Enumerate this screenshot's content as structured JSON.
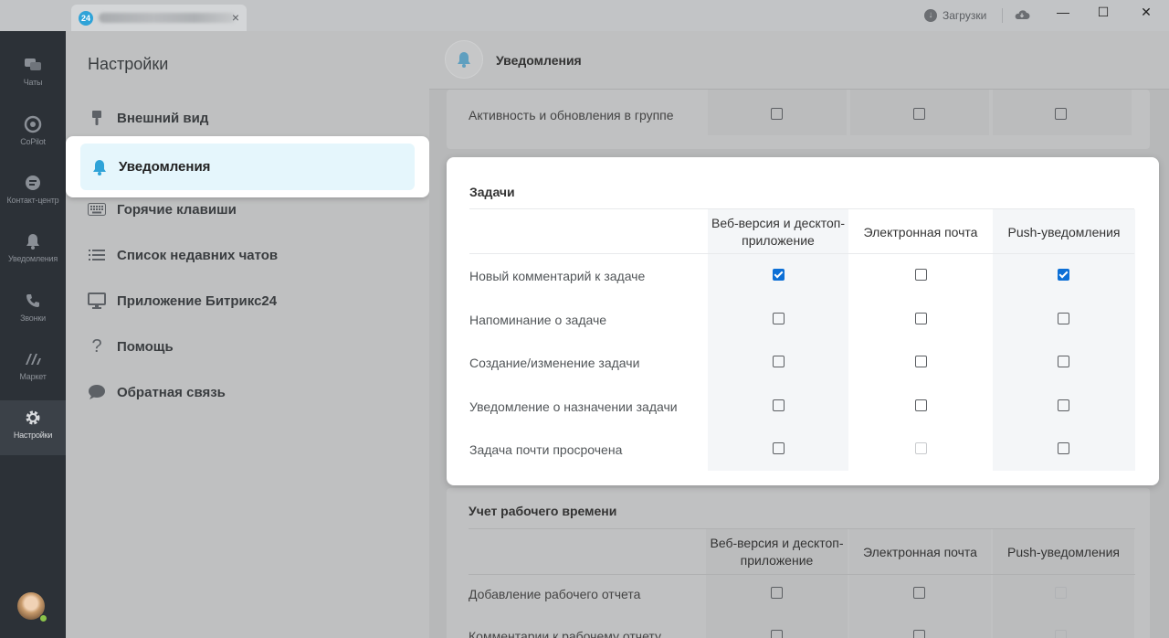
{
  "titlebar": {
    "tab_badge": "24",
    "tab_close": "×",
    "downloads_label": "Загрузки",
    "minimize": "—",
    "maximize": "☐",
    "close": "✕"
  },
  "sidebar": {
    "items": [
      {
        "label": "Чаты",
        "icon": "chat-icon"
      },
      {
        "label": "CoPilot",
        "icon": "copilot-icon"
      },
      {
        "label": "Контакт-центр",
        "icon": "contact-center-icon"
      },
      {
        "label": "Уведомления",
        "icon": "bell-icon"
      },
      {
        "label": "Звонки",
        "icon": "phone-icon"
      },
      {
        "label": "Маркет",
        "icon": "market-icon"
      },
      {
        "label": "Настройки",
        "icon": "gear-icon"
      }
    ]
  },
  "settings_nav": {
    "title": "Настройки",
    "items": [
      {
        "label": "Внешний вид",
        "icon": "brush-icon"
      },
      {
        "label": "Уведомления",
        "icon": "bell-icon"
      },
      {
        "label": "Горячие клавиши",
        "icon": "keyboard-icon"
      },
      {
        "label": "Список недавних чатов",
        "icon": "list-icon"
      },
      {
        "label": "Приложение Битрикс24",
        "icon": "monitor-icon"
      },
      {
        "label": "Помощь",
        "icon": "question-icon"
      },
      {
        "label": "Обратная связь",
        "icon": "speech-bubble-icon"
      }
    ]
  },
  "main": {
    "header_title": "Уведомления",
    "group_row": {
      "label": "Активность и обновления в группе",
      "values": [
        false,
        false,
        false
      ]
    },
    "columns": [
      "Веб-версия и десктоп-приложение",
      "Электронная почта",
      "Push-уведомления"
    ],
    "tasks": {
      "title": "Задачи",
      "rows": [
        {
          "label": "Новый комментарий к задаче",
          "values": [
            true,
            false,
            true
          ]
        },
        {
          "label": "Напоминание о задаче",
          "values": [
            false,
            false,
            false
          ]
        },
        {
          "label": "Создание/изменение задачи",
          "values": [
            false,
            false,
            false
          ]
        },
        {
          "label": "Уведомление о назначении задачи",
          "values": [
            false,
            false,
            false
          ]
        },
        {
          "label": "Задача почти просрочена",
          "values": [
            false,
            "disabled",
            false
          ]
        }
      ]
    },
    "time_tracking": {
      "title": "Учет рабочего времени",
      "rows": [
        {
          "label": "Добавление рабочего отчета",
          "values": [
            false,
            false,
            "disabled"
          ]
        },
        {
          "label": "Комментарии к рабочему отчету",
          "values": [
            false,
            false,
            "disabled"
          ]
        }
      ]
    }
  },
  "colors": {
    "accent": "#0c6fd6",
    "bell": "#2fa3d8",
    "highlight_bg": "#e5f6fc"
  }
}
